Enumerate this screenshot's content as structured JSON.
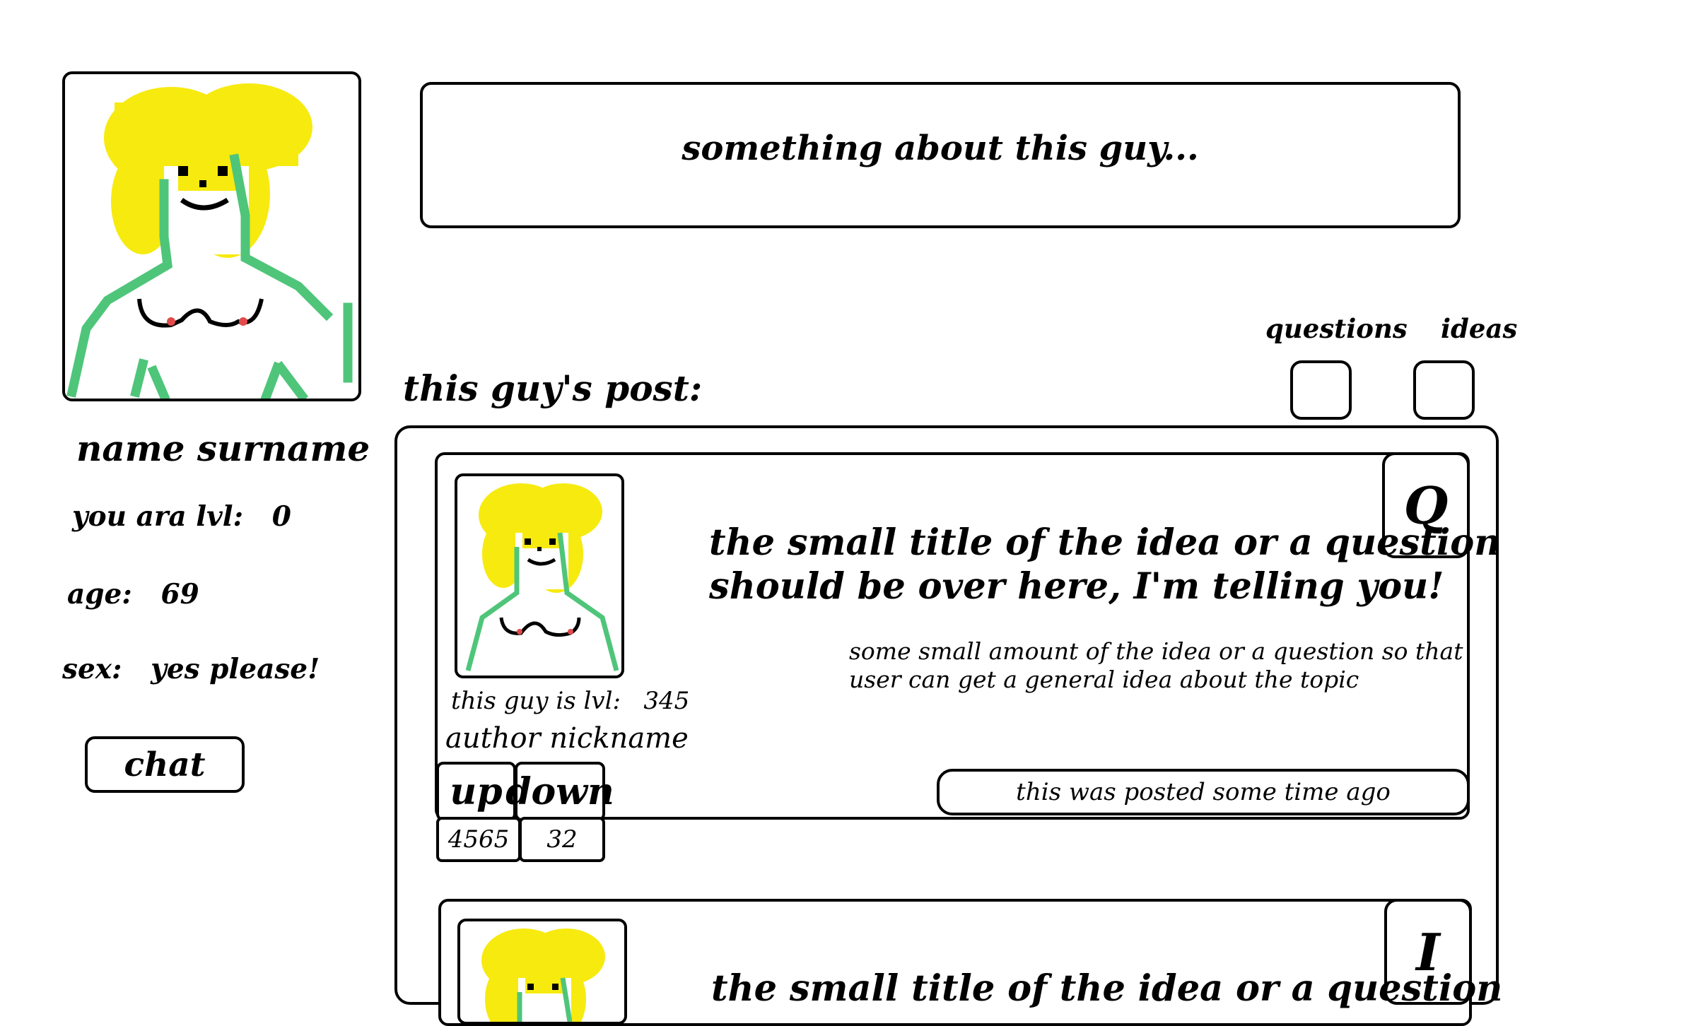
{
  "profile": {
    "name": "name surname",
    "level_label": "you ara lvl:",
    "level_value": "0",
    "age_label": "age:",
    "age_value": "69",
    "sex_label": "sex:",
    "sex_value": "yes please!",
    "chat_label": "chat"
  },
  "about": {
    "text": "something about this guy..."
  },
  "filters": {
    "questions_label": "questions",
    "ideas_label": "ideas"
  },
  "posts_section": {
    "title": "this guy's post:"
  },
  "posts": [
    {
      "type_letter": "Q",
      "title_line1": "the small title of the idea or a question",
      "title_line2": "should be over here, I'm telling you!",
      "excerpt_line1": "some small amount of the idea or a question so that",
      "excerpt_line2": "user can get a general idea about the topic",
      "author_level_label": "this guy is lvl:",
      "author_level_value": "345",
      "author": "author nickname",
      "up_label": "up",
      "down_label": "down",
      "up_count": "4565",
      "down_count": "32",
      "time_text": "this was posted some time ago"
    },
    {
      "type_letter": "I",
      "title_line1": "the small title of the idea or a question"
    }
  ],
  "colors": {
    "hair": "#f7ea0f",
    "body_outline": "#4fc57a",
    "nipple": "#e24b4b",
    "ink": "#000000"
  },
  "icons": {
    "avatar": "hand-drawn-portrait"
  }
}
